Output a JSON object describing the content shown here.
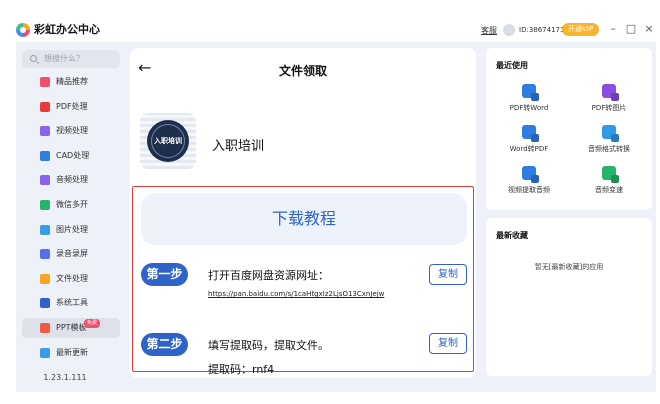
{
  "app": {
    "title": "彩虹办公中心"
  },
  "titlebar": {
    "link": "客服",
    "user_id": "ID:38674171",
    "vip_label": "开通VIP"
  },
  "sidebar": {
    "search_placeholder": "想搜什么？",
    "items": [
      {
        "label": "精品推荐",
        "icon": "star-icon",
        "color": "#f0506e"
      },
      {
        "label": "PDF处理",
        "icon": "pdf-icon",
        "color": "#e83a3a"
      },
      {
        "label": "视频处理",
        "icon": "video-icon",
        "color": "#8a63e8"
      },
      {
        "label": "CAD处理",
        "icon": "cad-icon",
        "color": "#2f7de1"
      },
      {
        "label": "音频处理",
        "icon": "music-icon",
        "color": "#8a63e8"
      },
      {
        "label": "微信多开",
        "icon": "wechat-icon",
        "color": "#27b36a"
      },
      {
        "label": "图片处理",
        "icon": "image-icon",
        "color": "#3a9be8"
      },
      {
        "label": "录音录屏",
        "icon": "record-icon",
        "color": "#5a6ee8"
      },
      {
        "label": "文件处理",
        "icon": "folder-icon",
        "color": "#f5a623"
      },
      {
        "label": "系统工具",
        "icon": "gear-icon",
        "color": "#2f63c9"
      },
      {
        "label": "PPT模板",
        "icon": "ppt-icon",
        "color": "#ef5b3c",
        "badge": "免费"
      },
      {
        "label": "最新更新",
        "icon": "update-icon",
        "color": "#3a9be8"
      }
    ],
    "version": "1.23.1.111"
  },
  "main": {
    "title": "文件领取",
    "thumb_text": "入职培训",
    "course_name": "入职培训",
    "tutorial_label": "下载教程",
    "steps": [
      {
        "label": "第一步",
        "text": "打开百度网盘资源网址：",
        "link": "https://pan.baidu.com/s/1caHtgxIz2LjsO13CxnJejw",
        "copy": "复制"
      },
      {
        "label": "第二步",
        "text": "填写提取码，提取文件。",
        "copy": "复制"
      }
    ],
    "partial_text": "提取码：rnf4"
  },
  "recent": {
    "title": "最近使用",
    "tools": [
      {
        "label": "PDF转Word",
        "icon": "pdf-to-word-icon",
        "color": "#2f7de1"
      },
      {
        "label": "PDF转图片",
        "icon": "pdf-to-image-icon",
        "color": "#8a4fe0"
      },
      {
        "label": "Word转PDF",
        "icon": "word-to-pdf-icon",
        "color": "#2f7de1"
      },
      {
        "label": "音频格式转换",
        "icon": "audio-convert-icon",
        "color": "#2f9be8"
      },
      {
        "label": "视频提取音频",
        "icon": "video-extract-audio-icon",
        "color": "#2f7de1"
      },
      {
        "label": "音频变速",
        "icon": "audio-speed-icon",
        "color": "#27b36a"
      }
    ]
  },
  "favorites": {
    "title": "最新收藏",
    "empty_text": "暂无[最新收藏]的应用"
  }
}
